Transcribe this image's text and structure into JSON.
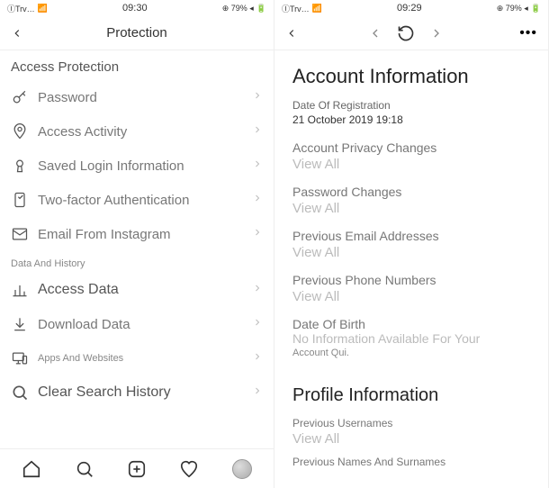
{
  "left": {
    "status": {
      "carrier": "ⒾTrv…",
      "wifi": "▾",
      "time": "09:30",
      "battery_text": "⊕ 79% ◂",
      "battery_icon": "▮▯"
    },
    "header": {
      "title": "Protection"
    },
    "sections": {
      "access_protection": "Access Protection",
      "data_history": "Data And History"
    },
    "items": {
      "password": "Password",
      "access_activity": "Access Activity",
      "saved_login": "Saved Login Information",
      "two_factor": "Two-factor Authentication",
      "email_from_ig": "Email From Instagram",
      "access_data": "Access Data",
      "download_data": "Download Data",
      "apps_websites": "Apps And Websites",
      "clear_search": "Clear Search History"
    }
  },
  "right": {
    "status": {
      "carrier": "ⒾTrv…",
      "wifi": "▾",
      "time": "09:29",
      "battery_text": "⊕ 79% ◂",
      "battery_icon": "▮▯"
    },
    "header": {
      "dots": "•••"
    },
    "page": {
      "account_info_title": "Account Information",
      "date_reg_label": "Date Of Registration",
      "date_reg_value": "21 October 2019 19:18",
      "privacy_changes": "Account Privacy Changes",
      "password_changes": "Password Changes",
      "prev_emails": "Previous Email Addresses",
      "prev_phones": "Previous Phone Numbers",
      "dob_label": "Date Of Birth",
      "dob_value1": "No Information Available For Your",
      "dob_value2": "Account Qui.",
      "profile_info_title": "Profile Information",
      "prev_usernames": "Previous Usernames",
      "prev_names": "Previous Names And Surnames",
      "view_all": "View All"
    }
  }
}
